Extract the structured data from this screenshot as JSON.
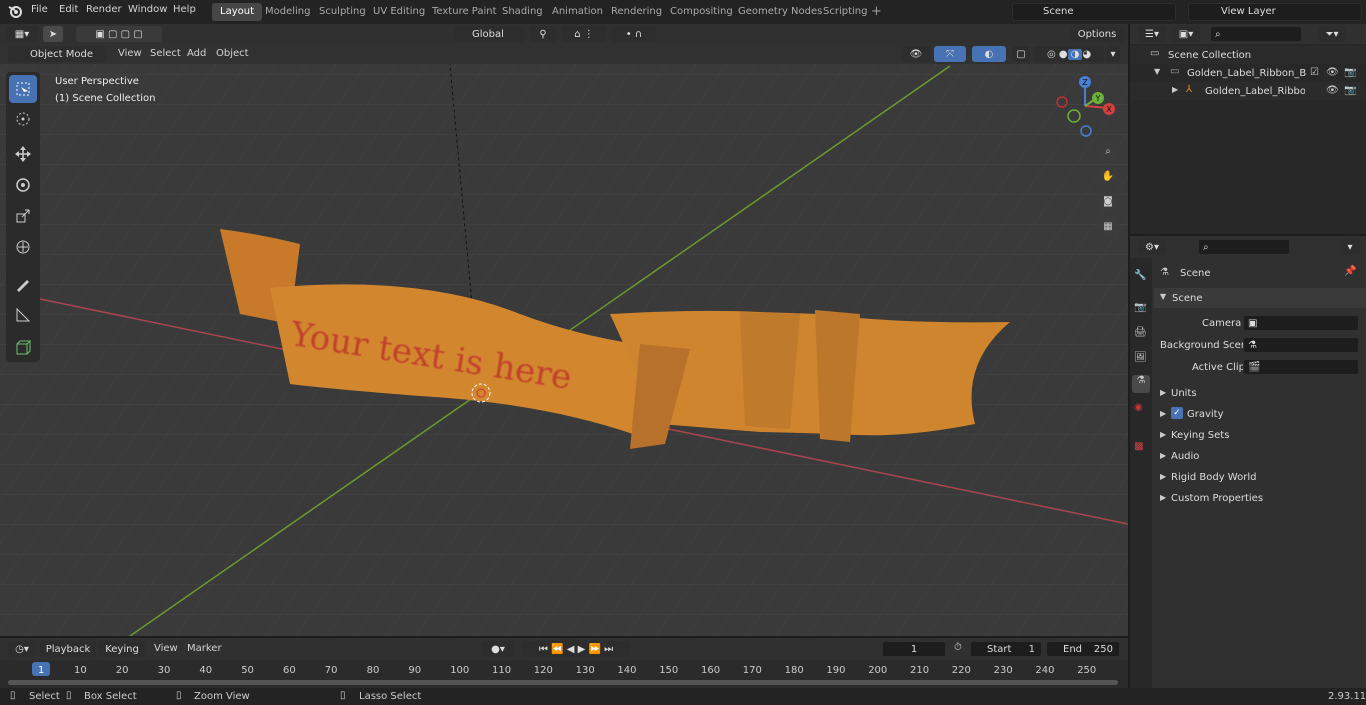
{
  "menu": [
    "File",
    "Edit",
    "Render",
    "Window",
    "Help"
  ],
  "workspaces": [
    "Layout",
    "Modeling",
    "Sculpting",
    "UV Editing",
    "Texture Paint",
    "Shading",
    "Animation",
    "Rendering",
    "Compositing",
    "Geometry Nodes",
    "Scripting"
  ],
  "scene_field": "Scene",
  "view_layer_field": "View Layer",
  "viewport": {
    "mode": "Object Mode",
    "menus": [
      "View",
      "Select",
      "Add",
      "Object"
    ],
    "transform_orientation": "Global",
    "options_label": "Options",
    "overlay_title": "User Perspective",
    "overlay_subtitle": "(1) Scene Collection",
    "banner_text": "Your text is here",
    "gizmo": {
      "x": "X",
      "y": "Y",
      "z": "Z"
    }
  },
  "outliner": {
    "root": "Scene Collection",
    "items": [
      "Golden_Label_Ribbon_Banne",
      "Golden_Label_Ribbon_Ba"
    ]
  },
  "properties": {
    "context": "Scene",
    "panel": "Scene",
    "camera_label": "Camera",
    "background_label": "Background Scene",
    "clip_label": "Active Clip",
    "sections": [
      "Units",
      "Gravity",
      "Keying Sets",
      "Audio",
      "Rigid Body World",
      "Custom Properties"
    ]
  },
  "timeline": {
    "menus": [
      "Playback",
      "Keying",
      "View",
      "Marker"
    ],
    "current_frame": "1",
    "start_label": "Start",
    "start": "1",
    "end_label": "End",
    "end": "250",
    "ticks": [
      "1",
      "10",
      "20",
      "30",
      "40",
      "50",
      "60",
      "70",
      "80",
      "90",
      "100",
      "110",
      "120",
      "130",
      "140",
      "150",
      "160",
      "170",
      "180",
      "190",
      "200",
      "210",
      "220",
      "230",
      "240",
      "250"
    ]
  },
  "statusbar": {
    "select": "Select",
    "box_select": "Box Select",
    "zoom": "Zoom View",
    "lasso": "Lasso Select",
    "version": "2.93.11"
  },
  "colors": {
    "accent": "#4772b3",
    "banner": "#d2872f",
    "text_red": "#c0392b"
  }
}
